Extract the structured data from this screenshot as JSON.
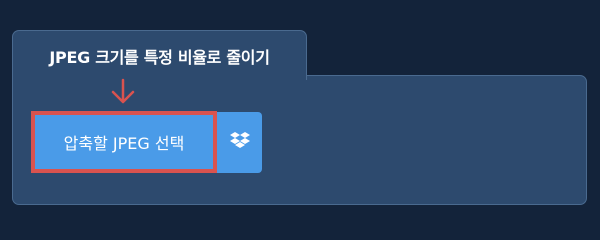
{
  "tab": {
    "title": "JPEG 크기를 특정 비율로 줄이기"
  },
  "buttons": {
    "select_label": "압축할 JPEG 선택",
    "dropbox_icon": "dropbox-icon"
  },
  "colors": {
    "background": "#13233a",
    "panel": "#2d4a6e",
    "button": "#4a9be8",
    "highlight": "#d9534f"
  }
}
